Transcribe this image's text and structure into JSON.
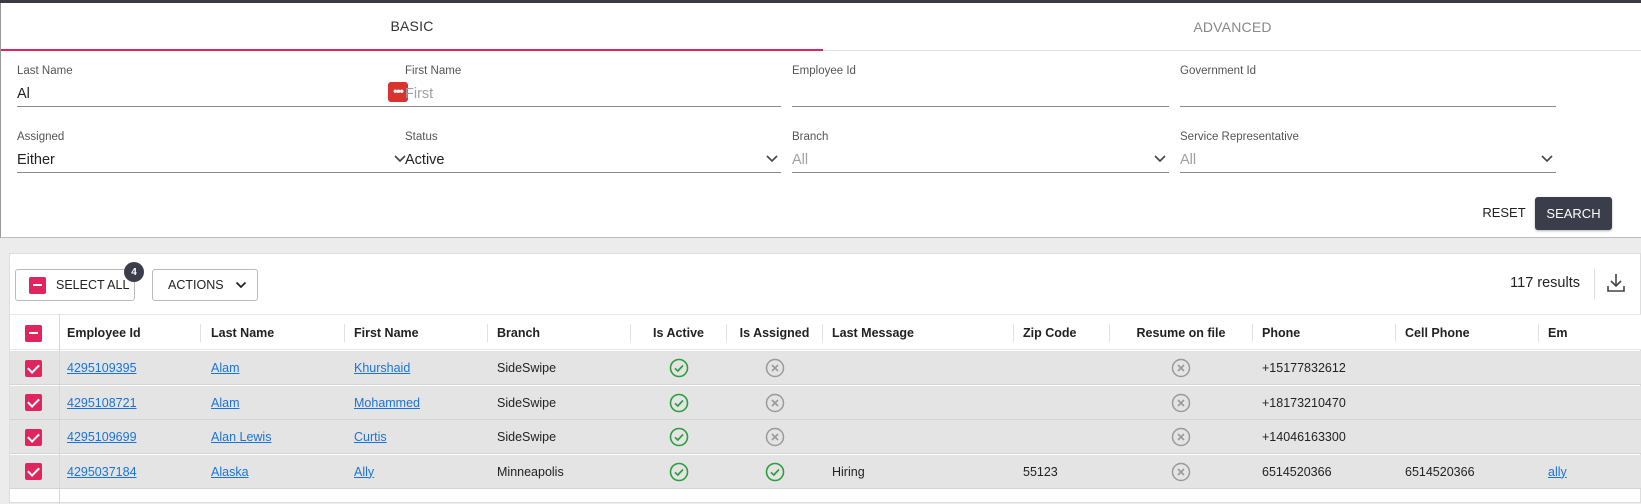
{
  "tabs": [
    {
      "label": "BASIC",
      "active": true
    },
    {
      "label": "ADVANCED",
      "active": false
    }
  ],
  "filters": {
    "last_name": {
      "label": "Last Name",
      "value": "Al",
      "placeholder": ""
    },
    "first_name": {
      "label": "First Name",
      "value": "",
      "placeholder": "First"
    },
    "employee_id": {
      "label": "Employee Id",
      "value": ""
    },
    "government_id": {
      "label": "Government Id",
      "value": ""
    },
    "assigned": {
      "label": "Assigned",
      "value": "Either"
    },
    "status": {
      "label": "Status",
      "value": "Active"
    },
    "branch": {
      "label": "Branch",
      "value": "All"
    },
    "service_rep": {
      "label": "Service Representative",
      "value": "All"
    }
  },
  "buttons": {
    "reset": "RESET",
    "search": "SEARCH",
    "select_all": "SELECT ALL",
    "actions": "ACTIONS"
  },
  "selected_count": "4",
  "results_count": "117 results",
  "colors": {
    "accent": "#e0245e",
    "dark": "#3c3d4a",
    "link": "#1a73d9",
    "success": "#2e9e3e",
    "neutral": "#9a9a9a"
  },
  "columns": [
    "Employee Id",
    "Last Name",
    "First Name",
    "Branch",
    "Is Active",
    "Is Assigned",
    "Last Message",
    "Zip Code",
    "Resume on file",
    "Phone",
    "Cell Phone",
    "Em"
  ],
  "rows": [
    {
      "employee_id": "4295109395",
      "last_name": "Alam",
      "first_name": "Khurshaid",
      "branch": "SideSwipe",
      "is_active": true,
      "is_assigned": false,
      "last_message": "",
      "zip": "",
      "resume": false,
      "phone": "+15177832612",
      "cell": "",
      "email": ""
    },
    {
      "employee_id": "4295108721",
      "last_name": "Alam",
      "first_name": "Mohammed",
      "branch": "SideSwipe",
      "is_active": true,
      "is_assigned": false,
      "last_message": "",
      "zip": "",
      "resume": false,
      "phone": "+18173210470",
      "cell": "",
      "email": ""
    },
    {
      "employee_id": "4295109699",
      "last_name": "Alan Lewis",
      "first_name": "Curtis",
      "branch": "SideSwipe",
      "is_active": true,
      "is_assigned": false,
      "last_message": "",
      "zip": "",
      "resume": false,
      "phone": "+14046163300",
      "cell": "",
      "email": ""
    },
    {
      "employee_id": "4295037184",
      "last_name": "Alaska",
      "first_name": "Ally",
      "branch": "Minneapolis",
      "is_active": true,
      "is_assigned": true,
      "last_message": "Hiring",
      "zip": "55123",
      "resume": false,
      "phone": "6514520366",
      "cell": "6514520366",
      "email": "ally"
    }
  ],
  "icons": {
    "password": "password-manager-icon",
    "chevron": "chevron-down-icon",
    "download": "download-icon",
    "check": "check-circle-icon",
    "x": "x-circle-icon"
  }
}
